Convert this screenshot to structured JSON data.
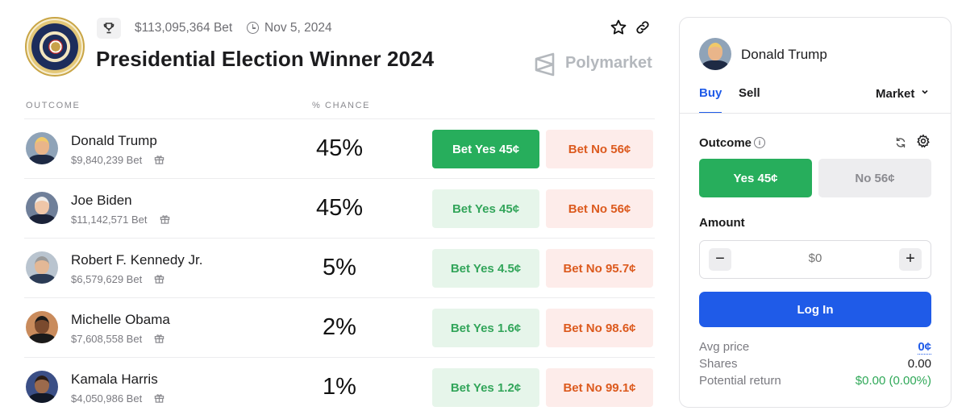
{
  "header": {
    "volume": "$113,095,364 Bet",
    "end_date": "Nov 5, 2024",
    "title": "Presidential Election Winner 2024",
    "brand": "Polymarket"
  },
  "table": {
    "col_outcome": "OUTCOME",
    "col_chance": "% CHANCE",
    "rows": [
      {
        "name": "Donald Trump",
        "volume": "$9,840,239 Bet",
        "chance": "45%",
        "yes": "Bet Yes 45¢",
        "no": "Bet No 56¢"
      },
      {
        "name": "Joe Biden",
        "volume": "$11,142,571 Bet",
        "chance": "45%",
        "yes": "Bet Yes 45¢",
        "no": "Bet No 56¢"
      },
      {
        "name": "Robert F. Kennedy Jr.",
        "volume": "$6,579,629 Bet",
        "chance": "5%",
        "yes": "Bet Yes 4.5¢",
        "no": "Bet No 95.7¢"
      },
      {
        "name": "Michelle Obama",
        "volume": "$7,608,558 Bet",
        "chance": "2%",
        "yes": "Bet Yes 1.6¢",
        "no": "Bet No 98.6¢"
      },
      {
        "name": "Kamala Harris",
        "volume": "$4,050,986 Bet",
        "chance": "1%",
        "yes": "Bet Yes 1.2¢",
        "no": "Bet No 99.1¢"
      }
    ]
  },
  "panel": {
    "candidate": "Donald Trump",
    "tab_buy": "Buy",
    "tab_sell": "Sell",
    "order_type": "Market",
    "outcome_label": "Outcome",
    "info_glyph": "i",
    "yes": "Yes 45¢",
    "no": "No 56¢",
    "amount_label": "Amount",
    "amount_minus": "−",
    "amount_plus": "+",
    "amount_placeholder": "$0",
    "login": "Log In",
    "avg_price_label": "Avg price",
    "avg_price": "0¢",
    "shares_label": "Shares",
    "shares": "0.00",
    "return_label": "Potential return",
    "return": "$0.00 (0.00%)"
  },
  "colors": {
    "yes_green": "#27ae5c",
    "no_orange": "#dc5a1e",
    "primary_blue": "#1f5be8"
  }
}
